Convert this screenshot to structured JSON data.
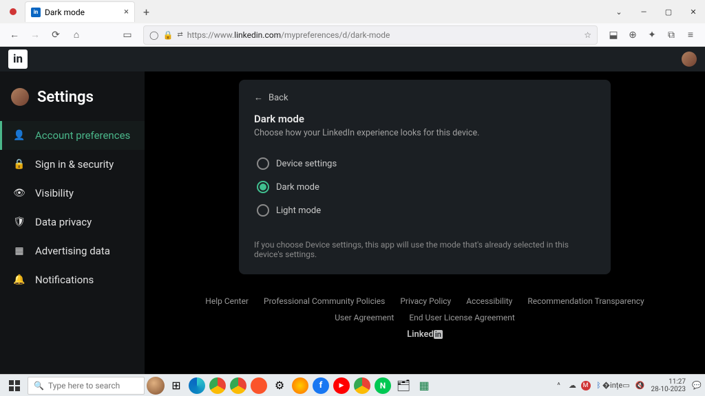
{
  "browser": {
    "tab_title": "Dark mode",
    "url_display": "https://www.linkedin.com/mypreferences/d/dark-mode",
    "url_domain": "linkedin.com"
  },
  "header": {
    "logo_text": "in"
  },
  "sidebar": {
    "title": "Settings",
    "items": [
      {
        "label": "Account preferences",
        "icon": "user"
      },
      {
        "label": "Sign in & security",
        "icon": "lock"
      },
      {
        "label": "Visibility",
        "icon": "eye"
      },
      {
        "label": "Data privacy",
        "icon": "shield"
      },
      {
        "label": "Advertising data",
        "icon": "news"
      },
      {
        "label": "Notifications",
        "icon": "bell"
      }
    ]
  },
  "card": {
    "back": "Back",
    "title": "Dark mode",
    "subtitle": "Choose how your LinkedIn experience looks for this device.",
    "options": [
      {
        "label": "Device settings"
      },
      {
        "label": "Dark mode"
      },
      {
        "label": "Light mode"
      }
    ],
    "selected": 1,
    "note": "If you choose Device settings, this app will use the mode that's already selected in this device's settings."
  },
  "footer": {
    "row1": [
      "Help Center",
      "Professional Community Policies",
      "Privacy Policy",
      "Accessibility",
      "Recommendation Transparency"
    ],
    "row2": [
      "User Agreement",
      "End User License Agreement"
    ],
    "brand_pre": "Linked",
    "brand_box": "in"
  },
  "taskbar": {
    "search_placeholder": "Type here to search",
    "time": "11:27",
    "date": "28-10-2023"
  }
}
